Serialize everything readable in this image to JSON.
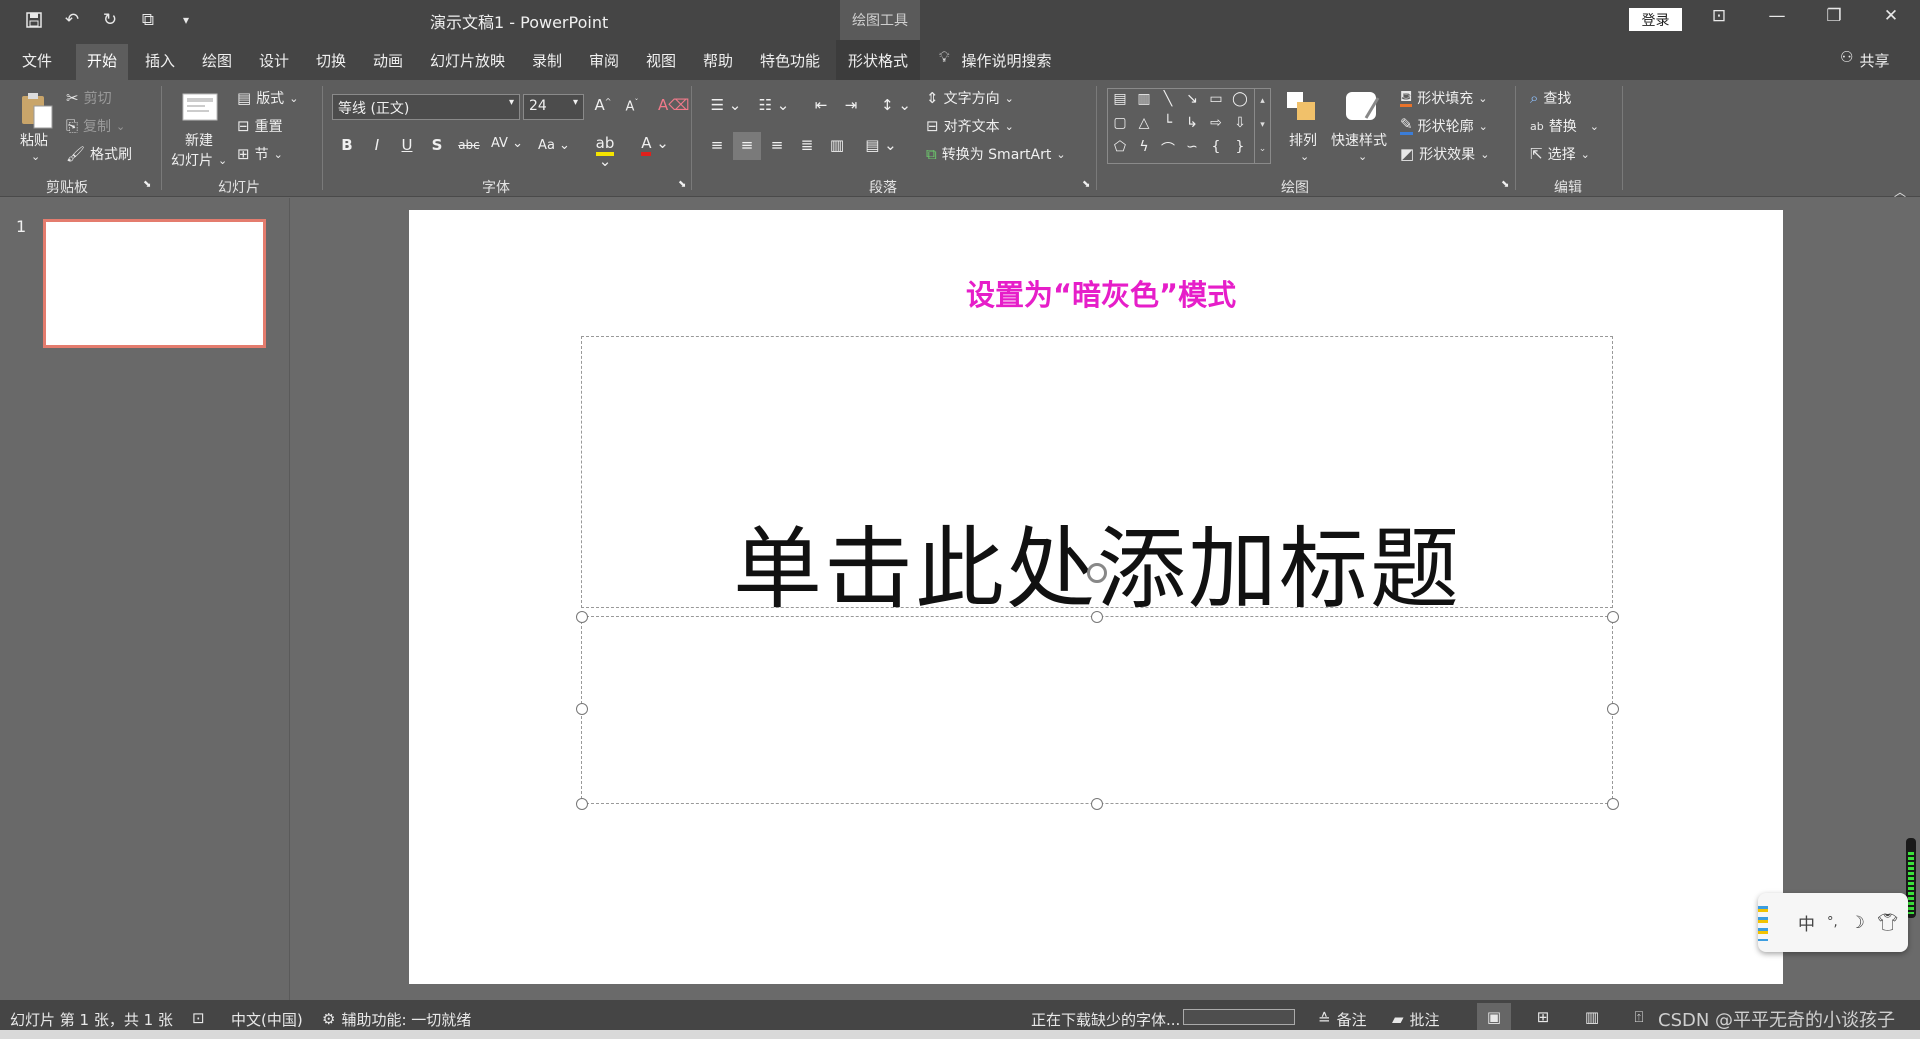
{
  "window": {
    "title": "演示文稿1  -  PowerPoint",
    "context_tools": "绘图工具",
    "login": "登录"
  },
  "tabs": {
    "file": "文件",
    "home": "开始",
    "insert": "插入",
    "draw": "绘图",
    "design": "设计",
    "transitions": "切换",
    "animations": "动画",
    "slideshow": "幻灯片放映",
    "record": "录制",
    "review": "审阅",
    "view": "视图",
    "help": "帮助",
    "features": "特色功能",
    "shape_format": "形状格式",
    "tell_me": "操作说明搜索",
    "share": "共享"
  },
  "ribbon": {
    "clipboard": {
      "label": "剪贴板",
      "paste": "粘贴",
      "cut": "剪切",
      "copy": "复制",
      "format_painter": "格式刷"
    },
    "slides": {
      "label": "幻灯片",
      "new_slide_line1": "新建",
      "new_slide_line2": "幻灯片",
      "layout": "版式",
      "reset": "重置",
      "section": "节"
    },
    "font": {
      "label": "字体",
      "font_name": "等线 (正文)",
      "font_size": "24",
      "change_case": "Aa"
    },
    "paragraph": {
      "label": "段落",
      "text_direction": "文字方向",
      "align_text": "对齐文本",
      "convert_smartart": "转换为 SmartArt"
    },
    "drawing": {
      "label": "绘图",
      "arrange": "排列",
      "quick_styles": "快速样式",
      "shape_fill": "形状填充",
      "shape_outline": "形状轮廓",
      "shape_effects": "形状效果"
    },
    "editing": {
      "label": "编辑",
      "find": "查找",
      "replace": "替换",
      "select": "选择"
    }
  },
  "thumbnails": {
    "slide_number": "1"
  },
  "slide": {
    "note": "设置为“暗灰色”模式",
    "title_placeholder": "单击此处添加标题"
  },
  "status": {
    "slide_info": "幻灯片 第 1 张，共 1 张",
    "language": "中文(中国)",
    "accessibility": "辅助功能: 一切就绪",
    "downloading": "正在下载缺少的字体...",
    "notes": "备注",
    "comments": "批注",
    "watermark": "CSDN @平平无奇的小谈孩子"
  },
  "ime": {
    "mode": "中"
  },
  "colors": {
    "note_color": "#e61ec9",
    "thumb_border": "#e47c6e"
  }
}
